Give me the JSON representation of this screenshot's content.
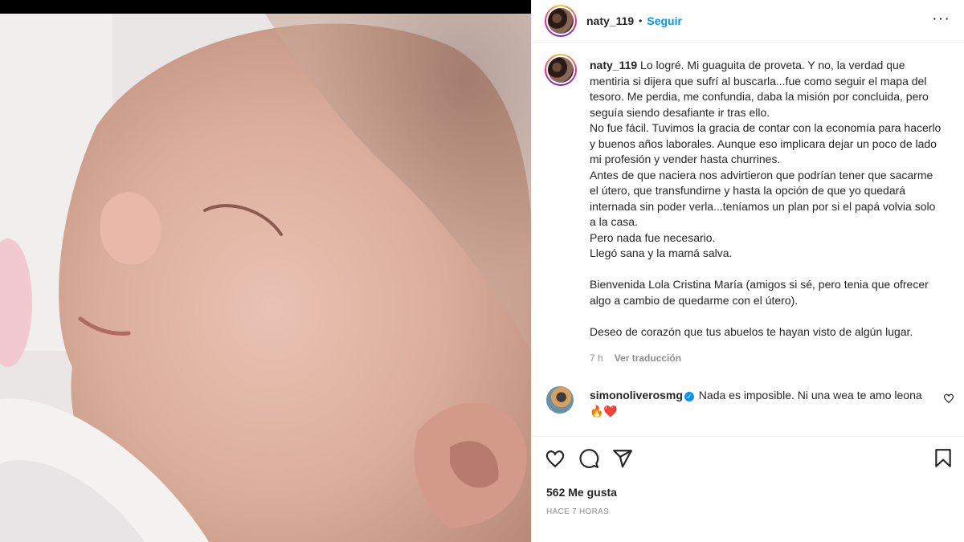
{
  "post": {
    "username": "naty_119",
    "follow_label": "Seguir",
    "dot": "•",
    "more_label": "···"
  },
  "caption": {
    "username": "naty_119",
    "text": " Lo logré. Mi guaguita de proveta. Y no, la verdad que mentiria si dijera que sufrí al buscarla...fue como seguir el mapa del tesoro. Me perdia, me confundia, daba la misión por concluida, pero seguía siendo desafiante ir tras ello.\nNo fue fácil. Tuvimos la gracia de contar con la economía para hacerlo y buenos años laborales. Aunque eso implicara dejar un poco de lado mi profesión y vender hasta churrines.\nAntes de que naciera nos advirtieron que podrían tener que sacarme el útero, que transfundirne y hasta la opción de que yo quedará internada sin poder verla...teníamos un plan por si el papá volvia solo a la casa.\nPero nada fue necesario.\nLlegó sana y la mamá salva.\n\nBienvenida Lola Cristina María (amigos si sé, pero tenia que ofrecer algo a cambio de quedarme con el útero).\n\nDeseo de corazón que tus abuelos te hayan visto de algún lugar.",
    "time": "7 h",
    "translate_label": "Ver traducción"
  },
  "comment": {
    "username": "simonoliverosmg",
    "verified_mark": "✓",
    "text": " Nada es imposible. Ni una wea te amo leona 🔥❤️"
  },
  "actions": {
    "like_icon": "heart-icon",
    "comment_icon": "comment-icon",
    "share_icon": "share-icon",
    "save_icon": "bookmark-icon"
  },
  "likes_label": "562 Me gusta",
  "time_ago": "HACE 7 HORAS"
}
